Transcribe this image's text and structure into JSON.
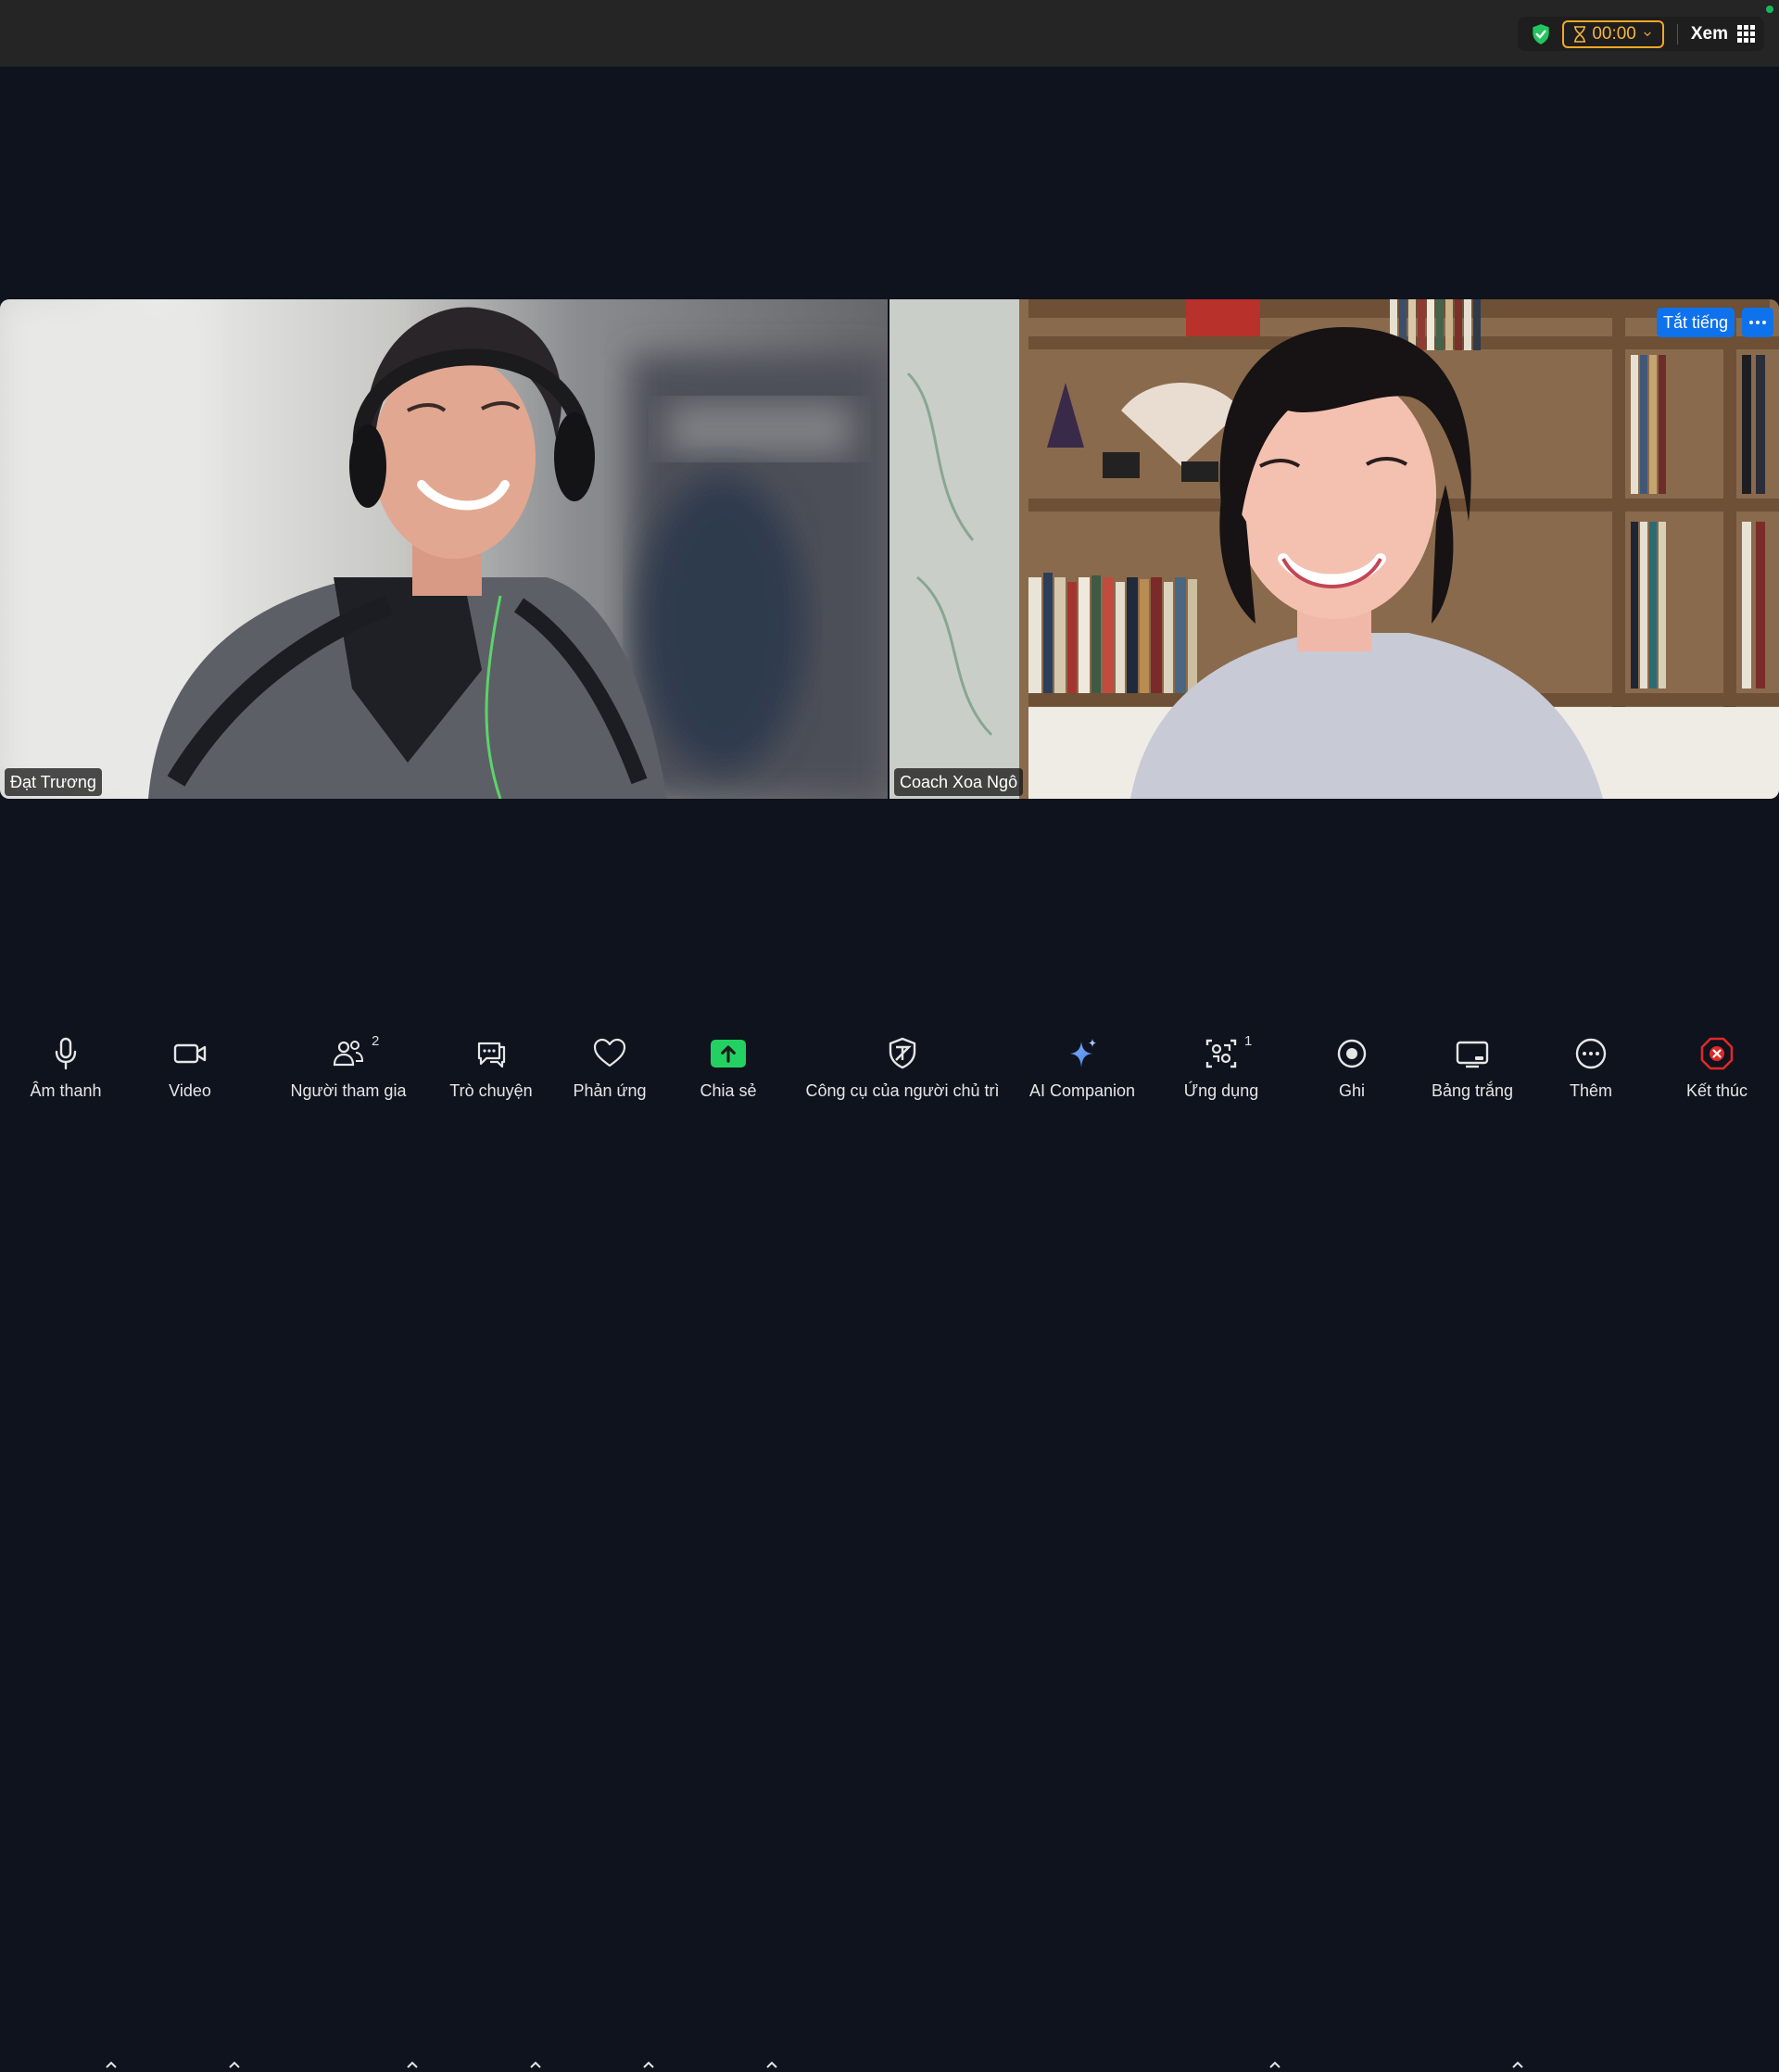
{
  "topbar": {
    "timer": "00:00",
    "view_label": "Xem"
  },
  "tiles": [
    {
      "name": "Đạt Trương"
    },
    {
      "name": "Coach Xoa Ngô",
      "mute_label": "Tắt tiếng"
    }
  ],
  "toolbar": {
    "audio": "Âm thanh",
    "video": "Video",
    "participants": "Người tham gia",
    "participants_count": "2",
    "chat": "Trò chuyện",
    "reactions": "Phản ứng",
    "share": "Chia sẻ",
    "host_tools": "Công cụ của người chủ trì",
    "ai_companion": "AI Companion",
    "apps": "Ứng dụng",
    "apps_count": "1",
    "record": "Ghi",
    "whiteboard": "Bảng trắng",
    "more": "Thêm",
    "end": "Kết thúc"
  },
  "colors": {
    "accent_blue": "#0e72ed",
    "share_green": "#23d163",
    "timer_orange": "#f5a623",
    "end_red": "#e02828"
  }
}
